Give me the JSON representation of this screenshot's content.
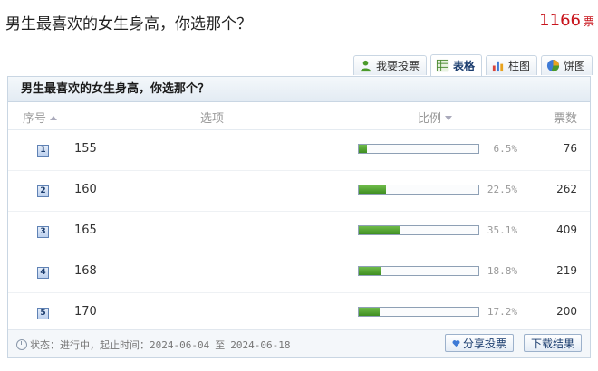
{
  "page": {
    "title": "男生最喜欢的女生身高，你选那个？",
    "total_votes": "1166",
    "votes_unit": "票"
  },
  "tabs": [
    {
      "label": "我要投票",
      "icon": "person-icon",
      "active": false
    },
    {
      "label": "表格",
      "icon": "table-icon",
      "active": true
    },
    {
      "label": "柱图",
      "icon": "bar-chart-icon",
      "active": false
    },
    {
      "label": "饼图",
      "icon": "pie-chart-icon",
      "active": false
    }
  ],
  "panel": {
    "title": "男生最喜欢的女生身高，你选那个？",
    "columns": {
      "rank": "序号",
      "option": "选项",
      "ratio": "比例",
      "votes": "票数"
    }
  },
  "chart_data": {
    "type": "table",
    "columns": [
      "序号",
      "选项",
      "比例",
      "票数"
    ],
    "rows": [
      {
        "rank": "1",
        "option": "155",
        "percent": 6.5,
        "percent_label": "6.5%",
        "votes": "76"
      },
      {
        "rank": "2",
        "option": "160",
        "percent": 22.5,
        "percent_label": "22.5%",
        "votes": "262"
      },
      {
        "rank": "3",
        "option": "165",
        "percent": 35.1,
        "percent_label": "35.1%",
        "votes": "409"
      },
      {
        "rank": "4",
        "option": "168",
        "percent": 18.8,
        "percent_label": "18.8%",
        "votes": "219"
      },
      {
        "rank": "5",
        "option": "170",
        "percent": 17.2,
        "percent_label": "17.2%",
        "votes": "200"
      }
    ]
  },
  "footer": {
    "status_label": "状态：进行中，起止时间：",
    "start_date": "2024-06-04",
    "date_sep": "至",
    "end_date": "2024-06-18",
    "share_label": "分享投票",
    "download_label": "下载结果",
    "icons": {
      "status": "clock-icon",
      "share": "heart-icon"
    }
  },
  "colors": {
    "accent_red": "#c8141c",
    "bar_green": "#4f9e2e",
    "border_blue": "#c9d6e3",
    "link_blue": "#1a3c6e"
  }
}
